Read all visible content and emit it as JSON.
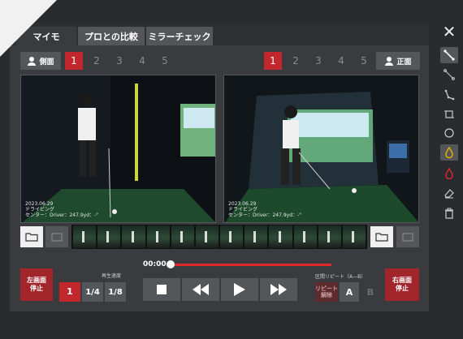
{
  "tabs": [
    {
      "label": "マイモ",
      "active": true
    },
    {
      "label": "プロとの比較",
      "active": false
    },
    {
      "label": "ミラーチェック",
      "active": false
    }
  ],
  "left_panel": {
    "view_label": "側面",
    "slots": [
      "1",
      "2",
      "3",
      "4",
      "5"
    ],
    "active_slot": "1",
    "video_info": [
      "2023.06.29",
      "ドライビング",
      "センター：Driver：247.9yd：-°"
    ]
  },
  "right_panel": {
    "view_label": "正面",
    "slots": [
      "1",
      "2",
      "3",
      "4",
      "5"
    ],
    "active_slot": "1",
    "video_info": [
      "2023.06.29",
      "ドライビング",
      "センター：Driver：247.9yd：-°"
    ]
  },
  "playback": {
    "time": "00:00",
    "progress": 0.0,
    "speed_label": "再生速度",
    "speeds": [
      "1",
      "1/4",
      "1/8"
    ],
    "active_speed": "1",
    "left_stop": "左画面\n停止",
    "right_stop": "右画面\n停止",
    "repeat_label": "区間リピート（A―B）",
    "repeat_release": "リピート\n解除",
    "a_label": "A",
    "b_label": "B"
  },
  "tools": [
    "line-icon",
    "line-thin-icon",
    "angle-icon",
    "crop-icon",
    "circle-icon",
    "drop-yellow-icon",
    "drop-red-icon",
    "eraser-icon",
    "trash-icon"
  ],
  "colors": {
    "accent_red": "#c1272d",
    "tool_yellow": "#e8b400",
    "tool_red": "#e0282d"
  }
}
